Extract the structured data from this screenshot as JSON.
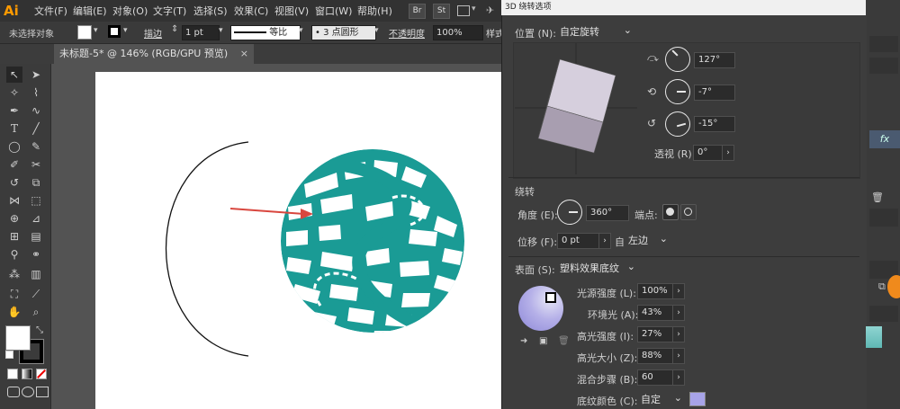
{
  "app": {
    "logo": "Ai"
  },
  "menu": [
    "文件(F)",
    "编辑(E)",
    "对象(O)",
    "文字(T)",
    "选择(S)",
    "效果(C)",
    "视图(V)",
    "窗口(W)",
    "帮助(H)"
  ],
  "menu_buttons": [
    "Br",
    "St"
  ],
  "control_bar": {
    "selection": "未选择对象",
    "stroke_label": "描边",
    "stroke_value": "1 pt",
    "stroke_profile": "等比",
    "brush": "3 点圆形",
    "opacity_label": "不透明度",
    "opacity_value": "100%",
    "style_label": "样式"
  },
  "document": {
    "tab_title": "未标题-5* @ 146% (RGB/GPU 预览)"
  },
  "dialog": {
    "title": "3D 绕转选项",
    "position_label": "位置 (N):",
    "position_value": "自定旋转",
    "rot_x": "127°",
    "rot_y": "-7°",
    "rot_z": "-15°",
    "perspective_label": "透视 (R):",
    "perspective_value": "0°",
    "revolve_section": "绕转",
    "angle_label": "角度 (E):",
    "angle_value": "360°",
    "cap_label": "端点:",
    "offset_label": "位移 (F):",
    "offset_value": "0 pt",
    "from_label": "自",
    "from_value": "左边",
    "surface_label": "表面 (S):",
    "surface_value": "塑料效果底纹",
    "light_intensity_label": "光源强度 (L):",
    "light_intensity_value": "100%",
    "ambient_label": "环境光 (A):",
    "ambient_value": "43%",
    "highlight_intensity_label": "高光强度 (I):",
    "highlight_intensity_value": "27%",
    "highlight_size_label": "高光大小 (Z):",
    "highlight_size_value": "88%",
    "blend_steps_label": "混合步骤 (B):",
    "blend_steps_value": "60",
    "shading_color_label": "底纹颜色 (C):",
    "shading_color_value": "自定"
  },
  "right_panel": {
    "fx": "fx"
  },
  "colors": {
    "teal": "#1a9b95",
    "arrow": "#d9473f",
    "cube": "#c9c0cf",
    "shading_swatch": "#a7a3e8"
  }
}
